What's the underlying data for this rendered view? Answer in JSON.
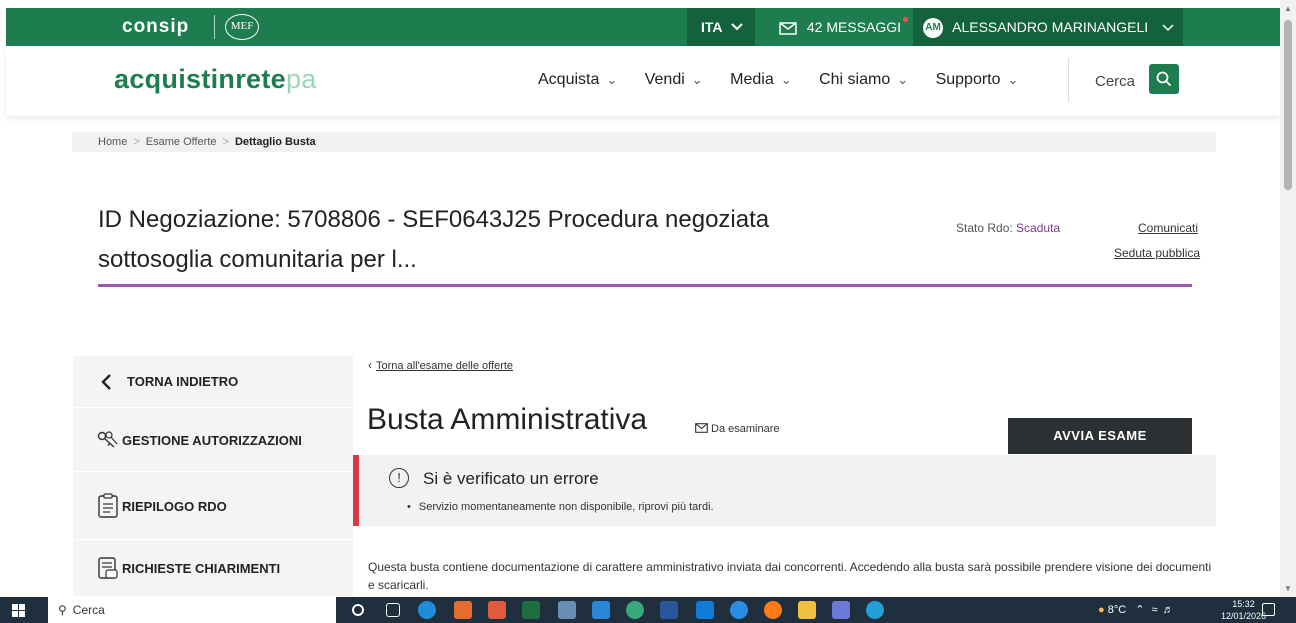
{
  "header": {
    "brand": "consip",
    "mef": "MEF",
    "language": "ITA",
    "messages": "42 MESSAGGI",
    "user_initials": "AM",
    "user_name": "ALESSANDRO MARINANGELI"
  },
  "nav": {
    "logo_bold": "acquistin",
    "logo_rete": "rete",
    "logo_pa": "pa",
    "items": [
      {
        "label": "Acquista"
      },
      {
        "label": "Vendi"
      },
      {
        "label": "Media"
      },
      {
        "label": "Chi siamo"
      },
      {
        "label": "Supporto"
      }
    ],
    "search_label": "Cerca"
  },
  "breadcrumb": {
    "items": [
      "Home",
      "Esame Offerte",
      "Dettaglio Busta"
    ]
  },
  "page": {
    "title": "ID Negoziazione: 5708806 - SEF0643J25 Procedura negoziata sottosoglia comunitaria per l...",
    "stato_label": "Stato Rdo: ",
    "stato_value": "Scaduta",
    "link_comunicati": "Comunicati",
    "link_seduta": "Seduta pubblica"
  },
  "sidebar": {
    "items": [
      {
        "label": "TORNA INDIETRO",
        "icon": "chevron-left-icon"
      },
      {
        "label": "GESTIONE AUTORIZZAZIONI",
        "icon": "keys-icon"
      },
      {
        "label": "RIEPILOGO RDO",
        "icon": "clipboard-icon"
      },
      {
        "label": "RICHIESTE CHIARIMENTI",
        "icon": "document-chat-icon"
      }
    ]
  },
  "main": {
    "back_link": "Torna all'esame delle offerte",
    "busta_title": "Busta Amministrativa",
    "status_badge": "Da esaminare",
    "action_button": "AVVIA ESAME",
    "alert_title": "Si è verificato un errore",
    "alert_message": "Servizio momentaneamente non disponibile, riprovi più tardi.",
    "description": "Questa busta contiene documentazione di carattere amministrativo inviata dai concorrenti. Accedendo alla busta sarà possibile prendere visione dei documenti e scaricarli."
  },
  "taskbar": {
    "search_placeholder": "Cerca",
    "temperature": "8°C",
    "time": "15:32",
    "date": "12/01/2026"
  },
  "colors": {
    "brand_green": "#1e7d4f",
    "accent_purple": "#9b59b0",
    "error_red": "#d83a45"
  }
}
